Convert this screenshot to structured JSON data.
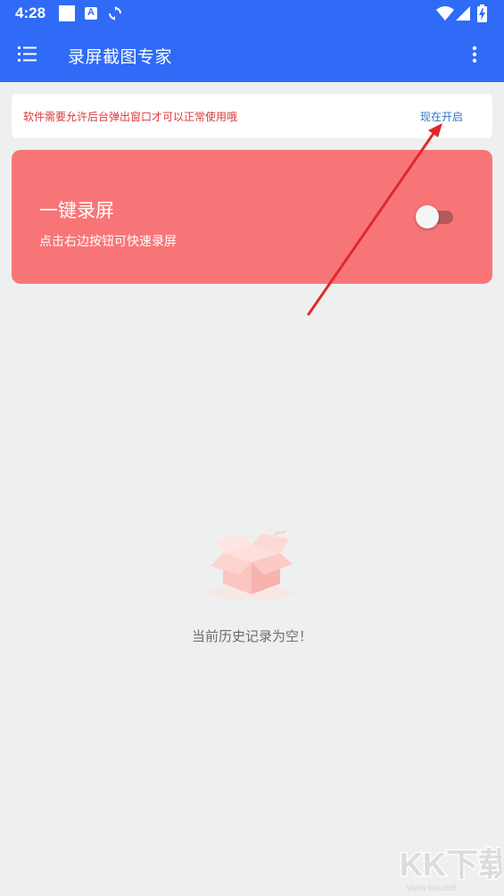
{
  "status_bar": {
    "time": "4:28",
    "icons": [
      "notification-square-icon",
      "a-letter-icon",
      "sync-icon",
      "wifi-icon",
      "signal-icon",
      "battery-charging-icon"
    ],
    "a_icon_letter": "A"
  },
  "app_bar": {
    "title": "录屏截图专家",
    "menu_icon": "menu-list-icon",
    "more_icon": "more-vert-icon",
    "background_color": "#2f6bf7"
  },
  "notice": {
    "text": "软件需要允许后台弹出窗口才可以正常使用哦",
    "action_label": "现在开启",
    "text_color": "#d93a3a",
    "action_color": "#2f74c7"
  },
  "record_card": {
    "title": "一键录屏",
    "subtitle": "点击右边按钮可快速录屏",
    "toggle_on": false,
    "card_color": "#f87577",
    "annotation_arrow_color": "#e0282c"
  },
  "empty_state": {
    "icon": "empty-box-icon",
    "message": "当前历史记录为空！"
  },
  "watermark": {
    "logo_text": "KK下载",
    "url": "www.kkx.net"
  }
}
